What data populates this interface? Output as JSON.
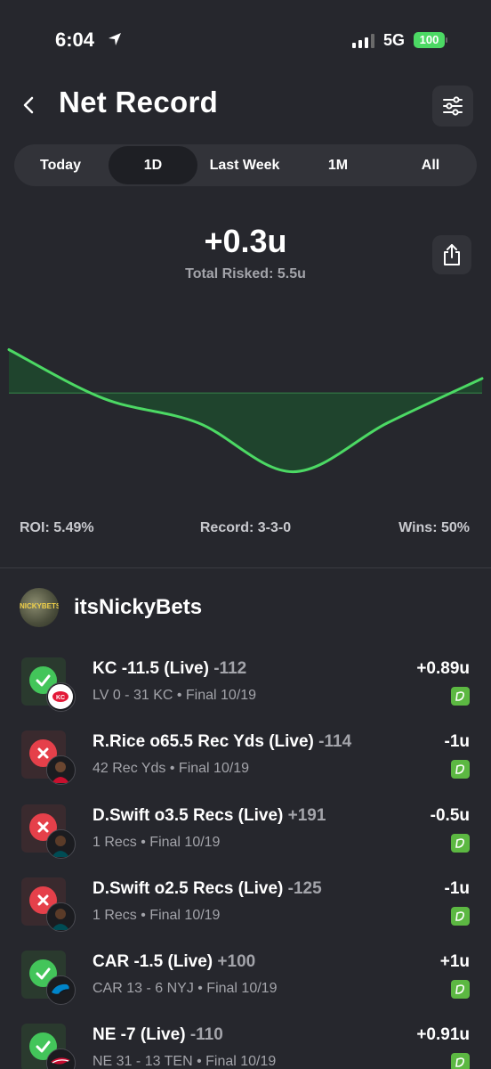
{
  "status_bar": {
    "time": "6:04",
    "network": "5G",
    "battery": "100"
  },
  "header": {
    "title": "Net Record"
  },
  "tabs": [
    {
      "label": "Today",
      "active": false
    },
    {
      "label": "1D",
      "active": true
    },
    {
      "label": "Last Week",
      "active": false
    },
    {
      "label": "1M",
      "active": false
    },
    {
      "label": "All",
      "active": false
    }
  ],
  "summary": {
    "net": "+0.3u",
    "total_risked": "Total Risked: 5.5u"
  },
  "chart_data": {
    "type": "area",
    "series": [
      {
        "values": [
          0.89,
          -0.11,
          -0.61,
          -1.61,
          -0.61,
          0.3
        ]
      }
    ],
    "baseline": 0,
    "colors": {
      "line": "#4cd964",
      "fill": "#1f4a2e",
      "baseline": "#2f6b3f"
    }
  },
  "stats": {
    "roi": "ROI: 5.49%",
    "record": "Record: 3-3-0",
    "wins": "Wins: 50%"
  },
  "user": {
    "name": "itsNickyBets",
    "avatar_text": "NICKYBETS"
  },
  "bets": [
    {
      "title": "KC -11.5 (Live)",
      "odds": "-112",
      "sub": "LV 0 - 31 KC • Final 10/19",
      "result": "+0.89u",
      "status": "win",
      "badge": "chiefs-logo-icon"
    },
    {
      "title": "R.Rice o65.5 Rec Yds (Live)",
      "odds": "-114",
      "sub": "42 Rec Yds • Final 10/19",
      "result": "-1u",
      "status": "loss",
      "badge": "player-headshot-icon"
    },
    {
      "title": "D.Swift o3.5 Recs (Live)",
      "odds": "+191",
      "sub": "1 Recs • Final 10/19",
      "result": "-0.5u",
      "status": "loss",
      "badge": "player-headshot-icon"
    },
    {
      "title": "D.Swift o2.5 Recs (Live)",
      "odds": "-125",
      "sub": "1 Recs • Final 10/19",
      "result": "-1u",
      "status": "loss",
      "badge": "player-headshot-icon"
    },
    {
      "title": "CAR -1.5 (Live)",
      "odds": "+100",
      "sub": "CAR 13 - 6 NYJ • Final 10/19",
      "result": "+1u",
      "status": "win",
      "badge": "panthers-logo-icon"
    },
    {
      "title": "NE -7 (Live)",
      "odds": "-110",
      "sub": "NE 31 - 13 TEN • Final 10/19",
      "result": "+0.91u",
      "status": "win",
      "badge": "patriots-logo-icon"
    }
  ]
}
